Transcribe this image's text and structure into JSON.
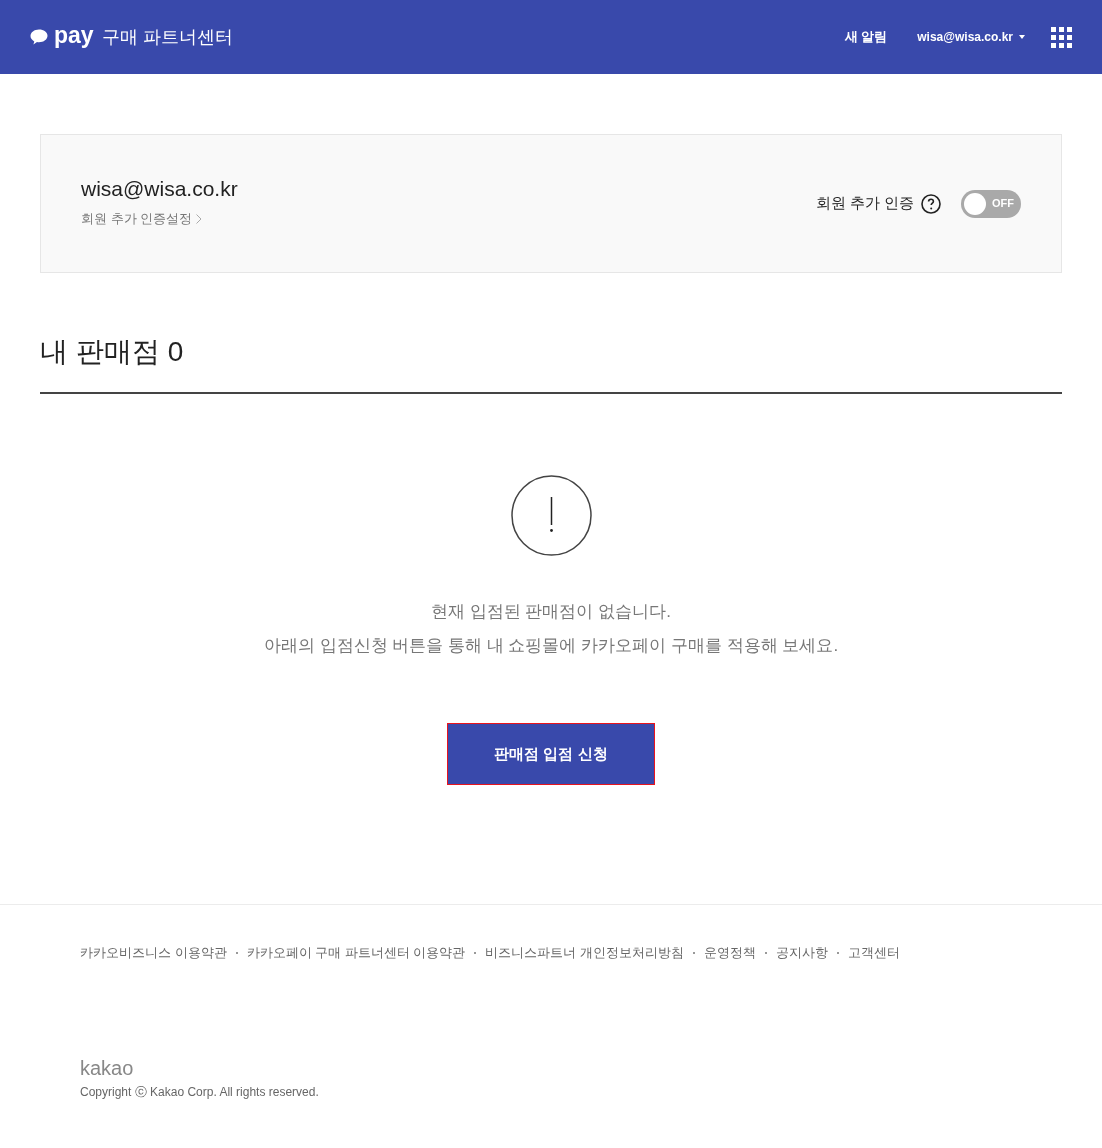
{
  "header": {
    "logo_word": "pay",
    "service_name": "구매 파트너센터",
    "notifications": "새 알림",
    "account": "wisa@wisa.co.kr"
  },
  "account_card": {
    "email": "wisa@wisa.co.kr",
    "settings_link": "회원 추가 인증설정",
    "auth_label": "회원 추가 인증",
    "toggle": {
      "on": false,
      "label": "OFF"
    }
  },
  "stores": {
    "title": "내 판매점",
    "count": "0"
  },
  "empty_state": {
    "lines": [
      "현재 입점된 판매점이 없습니다.",
      "아래의 입점신청 버튼을 통해 내 쇼핑몰에 카카오페이 구매를 적용해 보세요."
    ],
    "apply_button": "판매점 입점 신청"
  },
  "footer": {
    "links": [
      "카카오비즈니스 이용약관",
      "카카오페이 구매 파트너센터 이용약관",
      "비즈니스파트너 개인정보처리방침",
      "운영정책",
      "공지사항",
      "고객센터"
    ],
    "brand": "kakao",
    "copyright": "Copyright ⓒ Kakao Corp. All rights reserved."
  }
}
